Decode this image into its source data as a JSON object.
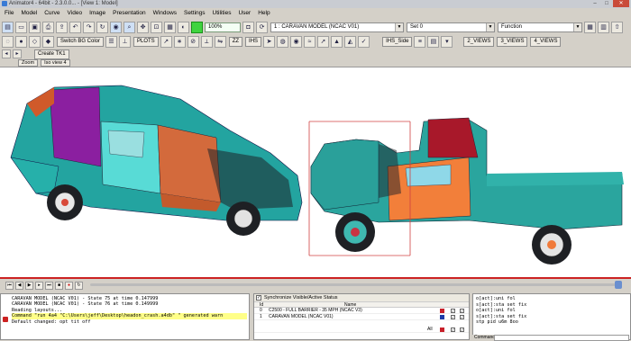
{
  "window": {
    "title": "Animator4 - 64bit - 2.3.0.0... - [View 1: Model]"
  },
  "menu": [
    "File",
    "Model",
    "Curve",
    "Video",
    "Image",
    "Presentation",
    "Windows",
    "Settings",
    "Utilities",
    "User",
    "Help"
  ],
  "toolbar1": {
    "zoom_value": "100%",
    "model_select": "1 : CARAVAN MODEL (NCAC V01)",
    "set_select": "Set 0",
    "function_select": "Function"
  },
  "toolbar2": {
    "switch_bg": "Switch BG Color",
    "plots": "PLOTS",
    "zz": "ZZ",
    "ihs": "IHS",
    "ihs_side": "IHS_Side",
    "views2": "2_VIEWS",
    "views3": "3_VIEWS",
    "views4": "4_VIEWS"
  },
  "toolbar3": {
    "create_tk": "Create TK1",
    "zoom": "Zoom",
    "iso_view": "Iso view 4"
  },
  "console": {
    "lines": [
      "CARAVAN MODEL (NCAC V01) - State 75 at time 0.147999",
      "CARAVAN MODEL (NCAC V01) - State 76 at time 0.149999",
      "Reading layouts...",
      "Command \"run 4a4 \"C:\\Users\\jeff\\Desktop\\headon_crash.a4db\" \" generated warn",
      "Default changed: opt tit off"
    ]
  },
  "status_panel": {
    "header": "Synchronize Visible/Active Status",
    "col_id": "Id",
    "col_name": "Name",
    "rows": [
      {
        "id": "0",
        "name": "C2500 - FULL BARRIER - 35 MPH (NCAC V3)"
      },
      {
        "id": "1",
        "name": "CARAVAN MODEL (NCAC V01)"
      }
    ],
    "all_label": "All"
  },
  "command_panel": {
    "lines": [
      "o[act]:uni fol",
      "s[act]:sta set fix",
      "o[act]:uni fol",
      "s[act]:sta set fix",
      "stp pid u6m 8oo"
    ],
    "input_label": "Command"
  },
  "colors": {
    "timeline_marker": "#cc2222",
    "accent": "#3fd43f"
  }
}
